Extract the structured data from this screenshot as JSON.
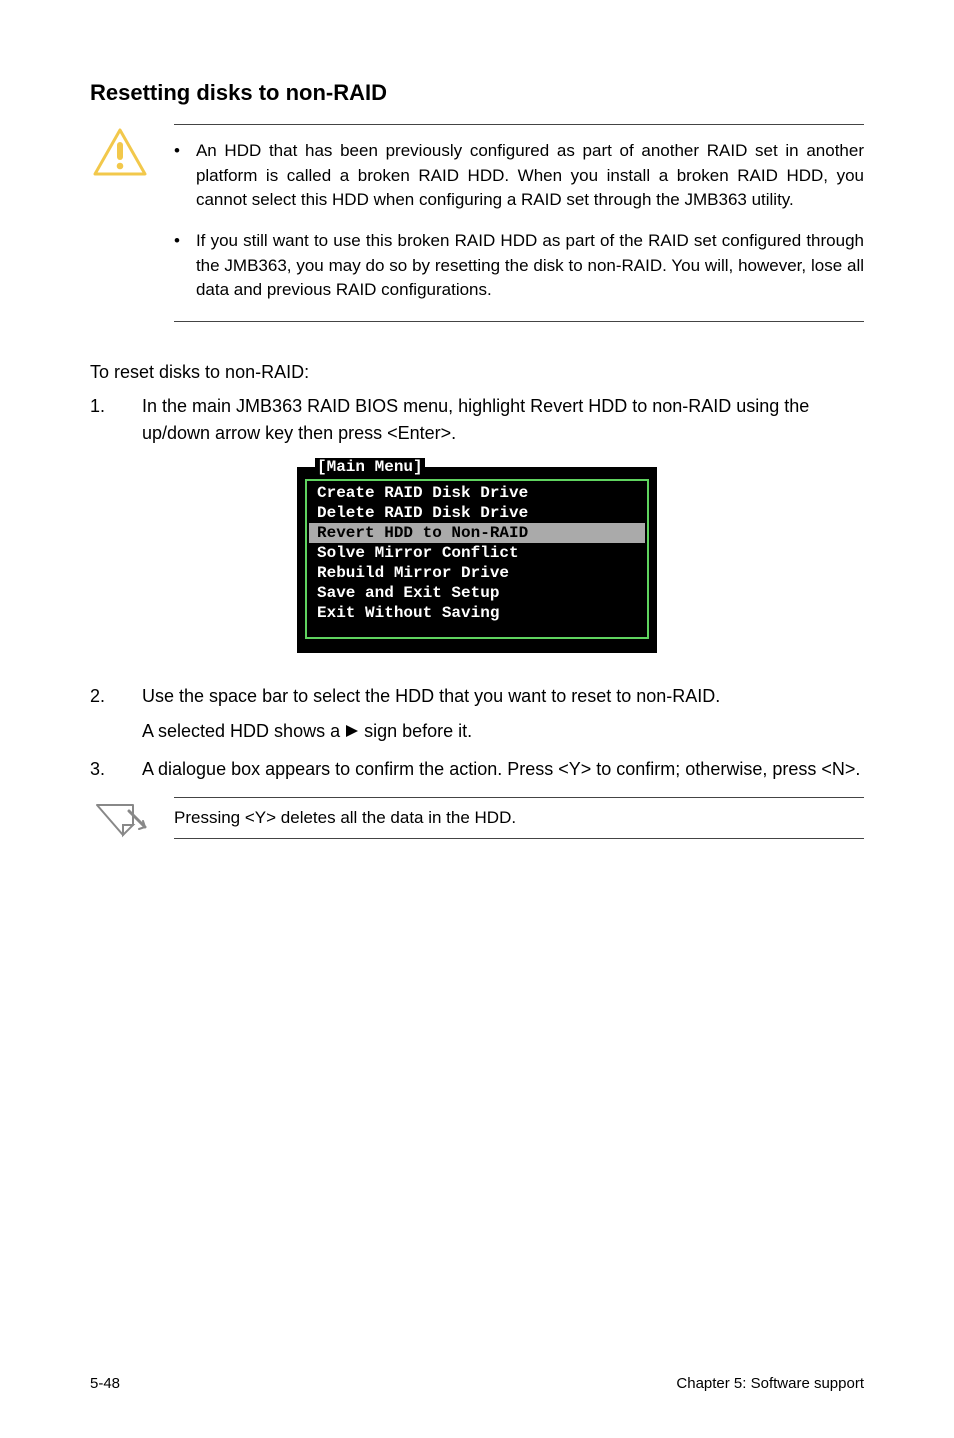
{
  "heading": "Resetting disks to non-RAID",
  "warning": {
    "bullets": [
      "An HDD that has been previously configured as part of another RAID set in another platform is called a broken RAID HDD. When you install a broken RAID HDD, you cannot select this HDD when configuring a RAID set through the JMB363 utility.",
      "If you still want to use this broken RAID HDD as part of the RAID set configured through the JMB363, you may do so by resetting the disk to non-RAID. You will, however, lose all data and previous RAID configurations."
    ]
  },
  "intro": "To reset disks to non-RAID:",
  "steps": [
    {
      "num": "1.",
      "text": "In the main JMB363 RAID BIOS menu, highlight Revert HDD to non-RAID using the up/down arrow key then press <Enter>."
    },
    {
      "num": "2.",
      "text_before": "Use the space bar to select the HDD that you want to reset to non-RAID.",
      "text_after_pre": "A selected HDD shows a ",
      "text_after_post": " sign before it."
    },
    {
      "num": "3.",
      "text": "A dialogue box appears to confirm the action. Press <Y> to confirm; otherwise, press <N>."
    }
  ],
  "bios": {
    "title": "[Main Menu]",
    "items": [
      {
        "label": "Create RAID Disk Drive",
        "selected": false
      },
      {
        "label": "Delete RAID Disk Drive",
        "selected": false
      },
      {
        "label": "Revert HDD to Non-RAID",
        "selected": true
      },
      {
        "label": "Solve Mirror Conflict",
        "selected": false
      },
      {
        "label": "Rebuild Mirror Drive",
        "selected": false
      },
      {
        "label": "Save and Exit Setup",
        "selected": false
      },
      {
        "label": "Exit Without Saving",
        "selected": false
      }
    ]
  },
  "note": "Pressing <Y> deletes all the data in the HDD.",
  "footer": {
    "left": "5-48",
    "right": "Chapter 5: Software support"
  }
}
